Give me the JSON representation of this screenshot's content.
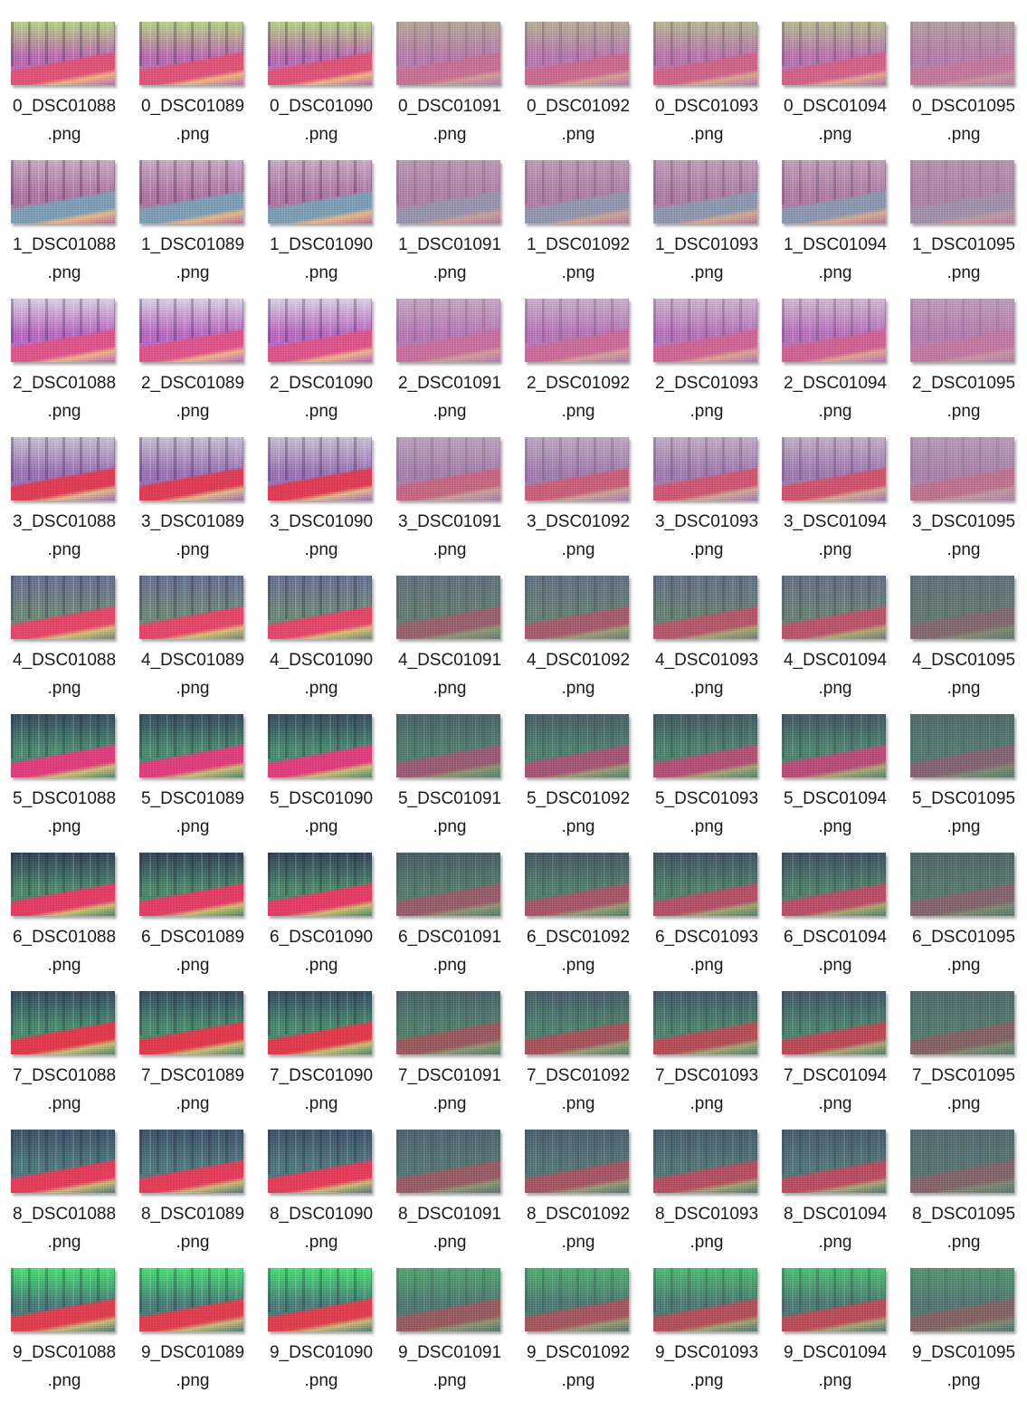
{
  "folder_view": {
    "extension": ".png",
    "row_prefixes": [
      "0",
      "1",
      "2",
      "3",
      "4",
      "5",
      "6",
      "7",
      "8",
      "9"
    ],
    "column_names": [
      "DSC01088",
      "DSC01089",
      "DSC01090",
      "DSC01091",
      "DSC01092",
      "DSC01093",
      "DSC01094",
      "DSC01095"
    ],
    "files": [
      {
        "name_line": "0_DSC01088",
        "ext_line": ".png"
      },
      {
        "name_line": "0_DSC01089",
        "ext_line": ".png"
      },
      {
        "name_line": "0_DSC01090",
        "ext_line": ".png"
      },
      {
        "name_line": "0_DSC01091",
        "ext_line": ".png"
      },
      {
        "name_line": "0_DSC01092",
        "ext_line": ".png"
      },
      {
        "name_line": "0_DSC01093",
        "ext_line": ".png"
      },
      {
        "name_line": "0_DSC01094",
        "ext_line": ".png"
      },
      {
        "name_line": "0_DSC01095",
        "ext_line": ".png"
      },
      {
        "name_line": "1_DSC01088",
        "ext_line": ".png"
      },
      {
        "name_line": "1_DSC01089",
        "ext_line": ".png"
      },
      {
        "name_line": "1_DSC01090",
        "ext_line": ".png"
      },
      {
        "name_line": "1_DSC01091",
        "ext_line": ".png"
      },
      {
        "name_line": "1_DSC01092",
        "ext_line": ".png"
      },
      {
        "name_line": "1_DSC01093",
        "ext_line": ".png"
      },
      {
        "name_line": "1_DSC01094",
        "ext_line": ".png"
      },
      {
        "name_line": "1_DSC01095",
        "ext_line": ".png"
      },
      {
        "name_line": "2_DSC01088",
        "ext_line": ".png"
      },
      {
        "name_line": "2_DSC01089",
        "ext_line": ".png"
      },
      {
        "name_line": "2_DSC01090",
        "ext_line": ".png"
      },
      {
        "name_line": "2_DSC01091",
        "ext_line": ".png"
      },
      {
        "name_line": "2_DSC01092",
        "ext_line": ".png"
      },
      {
        "name_line": "2_DSC01093",
        "ext_line": ".png"
      },
      {
        "name_line": "2_DSC01094",
        "ext_line": ".png"
      },
      {
        "name_line": "2_DSC01095",
        "ext_line": ".png"
      },
      {
        "name_line": "3_DSC01088",
        "ext_line": ".png"
      },
      {
        "name_line": "3_DSC01089",
        "ext_line": ".png"
      },
      {
        "name_line": "3_DSC01090",
        "ext_line": ".png"
      },
      {
        "name_line": "3_DSC01091",
        "ext_line": ".png"
      },
      {
        "name_line": "3_DSC01092",
        "ext_line": ".png"
      },
      {
        "name_line": "3_DSC01093",
        "ext_line": ".png"
      },
      {
        "name_line": "3_DSC01094",
        "ext_line": ".png"
      },
      {
        "name_line": "3_DSC01095",
        "ext_line": ".png"
      },
      {
        "name_line": "4_DSC01088",
        "ext_line": ".png"
      },
      {
        "name_line": "4_DSC01089",
        "ext_line": ".png"
      },
      {
        "name_line": "4_DSC01090",
        "ext_line": ".png"
      },
      {
        "name_line": "4_DSC01091",
        "ext_line": ".png"
      },
      {
        "name_line": "4_DSC01092",
        "ext_line": ".png"
      },
      {
        "name_line": "4_DSC01093",
        "ext_line": ".png"
      },
      {
        "name_line": "4_DSC01094",
        "ext_line": ".png"
      },
      {
        "name_line": "4_DSC01095",
        "ext_line": ".png"
      },
      {
        "name_line": "5_DSC01088",
        "ext_line": ".png"
      },
      {
        "name_line": "5_DSC01089",
        "ext_line": ".png"
      },
      {
        "name_line": "5_DSC01090",
        "ext_line": ".png"
      },
      {
        "name_line": "5_DSC01091",
        "ext_line": ".png"
      },
      {
        "name_line": "5_DSC01092",
        "ext_line": ".png"
      },
      {
        "name_line": "5_DSC01093",
        "ext_line": ".png"
      },
      {
        "name_line": "5_DSC01094",
        "ext_line": ".png"
      },
      {
        "name_line": "5_DSC01095",
        "ext_line": ".png"
      },
      {
        "name_line": "6_DSC01088",
        "ext_line": ".png"
      },
      {
        "name_line": "6_DSC01089",
        "ext_line": ".png"
      },
      {
        "name_line": "6_DSC01090",
        "ext_line": ".png"
      },
      {
        "name_line": "6_DSC01091",
        "ext_line": ".png"
      },
      {
        "name_line": "6_DSC01092",
        "ext_line": ".png"
      },
      {
        "name_line": "6_DSC01093",
        "ext_line": ".png"
      },
      {
        "name_line": "6_DSC01094",
        "ext_line": ".png"
      },
      {
        "name_line": "6_DSC01095",
        "ext_line": ".png"
      },
      {
        "name_line": "7_DSC01088",
        "ext_line": ".png"
      },
      {
        "name_line": "7_DSC01089",
        "ext_line": ".png"
      },
      {
        "name_line": "7_DSC01090",
        "ext_line": ".png"
      },
      {
        "name_line": "7_DSC01091",
        "ext_line": ".png"
      },
      {
        "name_line": "7_DSC01092",
        "ext_line": ".png"
      },
      {
        "name_line": "7_DSC01093",
        "ext_line": ".png"
      },
      {
        "name_line": "7_DSC01094",
        "ext_line": ".png"
      },
      {
        "name_line": "7_DSC01095",
        "ext_line": ".png"
      },
      {
        "name_line": "8_DSC01088",
        "ext_line": ".png"
      },
      {
        "name_line": "8_DSC01089",
        "ext_line": ".png"
      },
      {
        "name_line": "8_DSC01090",
        "ext_line": ".png"
      },
      {
        "name_line": "8_DSC01091",
        "ext_line": ".png"
      },
      {
        "name_line": "8_DSC01092",
        "ext_line": ".png"
      },
      {
        "name_line": "8_DSC01093",
        "ext_line": ".png"
      },
      {
        "name_line": "8_DSC01094",
        "ext_line": ".png"
      },
      {
        "name_line": "8_DSC01095",
        "ext_line": ".png"
      },
      {
        "name_line": "9_DSC01088",
        "ext_line": ".png"
      },
      {
        "name_line": "9_DSC01089",
        "ext_line": ".png"
      },
      {
        "name_line": "9_DSC01090",
        "ext_line": ".png"
      },
      {
        "name_line": "9_DSC01091",
        "ext_line": ".png"
      },
      {
        "name_line": "9_DSC01092",
        "ext_line": ".png"
      },
      {
        "name_line": "9_DSC01093",
        "ext_line": ".png"
      },
      {
        "name_line": "9_DSC01094",
        "ext_line": ".png"
      },
      {
        "name_line": "9_DSC01095",
        "ext_line": ".png"
      }
    ],
    "row_tints": [
      {
        "base": "#b86fb0",
        "sky": "#b7d08a",
        "ground": "#d9577e"
      },
      {
        "base": "#b077a6",
        "sky": "#c9a7c4",
        "ground": "#7fa0b7"
      },
      {
        "base": "#b66cbf",
        "sky": "#d9cfe0",
        "ground": "#d9588e"
      },
      {
        "base": "#9d74b7",
        "sky": "#c6c0d4",
        "ground": "#df3f55"
      },
      {
        "base": "#6f8a7c",
        "sky": "#6b7296",
        "ground": "#e04a6e"
      },
      {
        "base": "#4f8b72",
        "sky": "#3b4f5e",
        "ground": "#e0407a"
      },
      {
        "base": "#4c8a6e",
        "sky": "#34455e",
        "ground": "#e0406a"
      },
      {
        "base": "#4e8a70",
        "sky": "#3a4f62",
        "ground": "#e23c4e"
      },
      {
        "base": "#4f7b80",
        "sky": "#3f5570",
        "ground": "#e04060"
      },
      {
        "base": "#4d7e7a",
        "sky": "#48e070",
        "ground": "#e04050"
      }
    ],
    "column_fades": [
      0,
      0,
      0,
      0.55,
      0.45,
      0.35,
      0.3,
      0.7
    ],
    "thumbnail_icon": "image-thumbnail-icon"
  }
}
